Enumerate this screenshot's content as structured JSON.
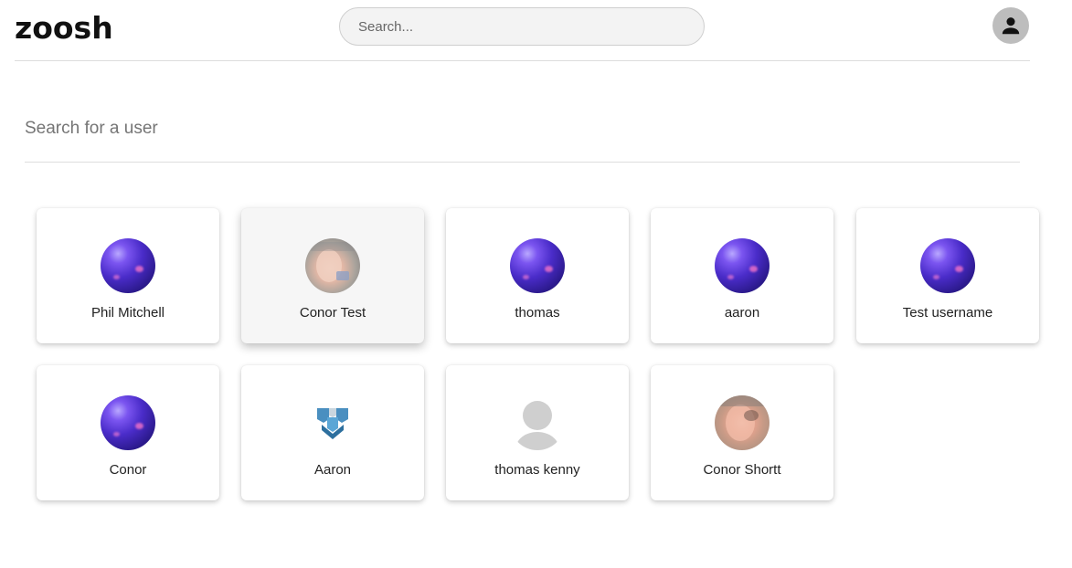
{
  "app": {
    "logo_text": "zoosh"
  },
  "header": {
    "search_placeholder": "Search...",
    "account_icon": "account-circle-icon"
  },
  "user_search": {
    "placeholder": "Search for a user",
    "value": ""
  },
  "users": [
    {
      "name": "Phil Mitchell",
      "avatar": "purple-orb"
    },
    {
      "name": "Conor Test",
      "avatar": "photo"
    },
    {
      "name": "thomas",
      "avatar": "purple-orb"
    },
    {
      "name": "aaron",
      "avatar": "purple-orb"
    },
    {
      "name": "Test username",
      "avatar": "purple-orb"
    },
    {
      "name": "Conor",
      "avatar": "purple-orb"
    },
    {
      "name": "Aaron",
      "avatar": "logo"
    },
    {
      "name": "thomas kenny",
      "avatar": "default-person"
    },
    {
      "name": "Conor Shortt",
      "avatar": "photo"
    }
  ],
  "colors": {
    "accent_orb": "#4a2cc9",
    "avatar_placeholder": "#cfcfcf",
    "account_button": "#bdbdbd"
  }
}
